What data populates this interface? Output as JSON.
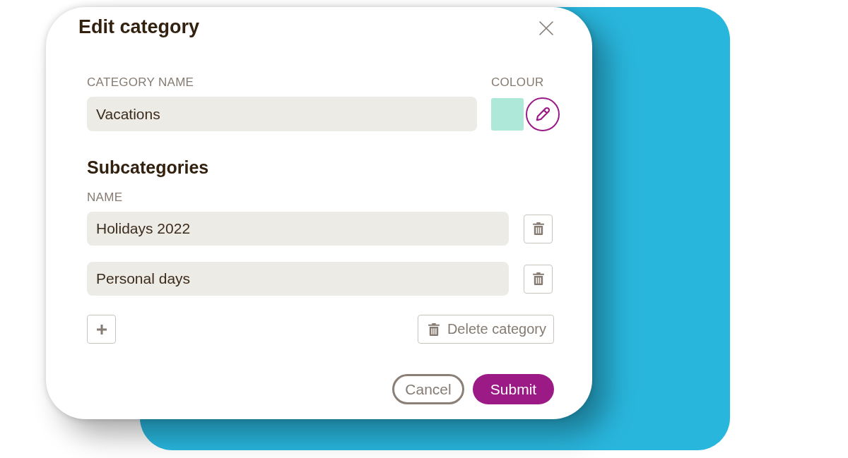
{
  "dialog": {
    "title": "Edit category"
  },
  "category": {
    "label": "CATEGORY NAME",
    "value": "Vacations"
  },
  "colour": {
    "label": "COLOUR",
    "color": "#ade8d9"
  },
  "subcategories": {
    "heading": "Subcategories",
    "column_label": "NAME",
    "items": [
      {
        "value": "Holidays 2022"
      },
      {
        "value": "Personal days"
      }
    ]
  },
  "delete_button": {
    "label": "Delete category"
  },
  "buttons": [
    {
      "label": "Cancel",
      "kind": "secondary"
    },
    {
      "label": "Submit",
      "kind": "primary"
    }
  ]
}
